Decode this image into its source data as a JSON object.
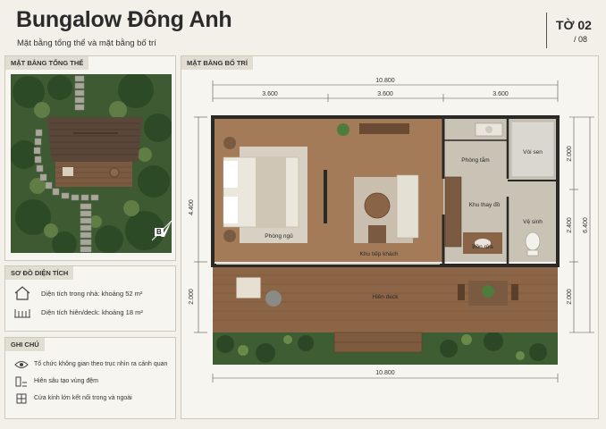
{
  "header": {
    "title": "Bungalow Đông Anh",
    "subtitle": "Mặt bằng tổng thể và mặt bằng bố trí",
    "sheet": "TỜ 02",
    "sheet_total": "/ 08"
  },
  "site_plan": {
    "label": "MẶT BẰNG TỔNG THỂ",
    "north_letter": "B"
  },
  "area_table": {
    "label": "SƠ ĐỒ DIỆN TÍCH",
    "rows": [
      {
        "icon": "house-icon",
        "text": "Diện tích trong nhà: khoảng 52 m²"
      },
      {
        "icon": "deck-icon",
        "text": "Diện tích hiên/deck: khoảng 18 m²"
      }
    ]
  },
  "notes": {
    "label": "GHI CHÚ",
    "rows": [
      {
        "icon": "eye-icon",
        "text": "Tổ chức không gian theo trục nhìn ra cảnh quan"
      },
      {
        "icon": "layers-icon",
        "text": "Hiên sâu tạo vùng đệm"
      },
      {
        "icon": "window-icon",
        "text": "Cửa kính lớn kết nối trong và ngoài"
      }
    ]
  },
  "floor_plan": {
    "label": "MẶT BẰNG BỐ TRÍ",
    "dim_total_top": "10.800",
    "dim_top": [
      "3.600",
      "3.600",
      "3.600"
    ],
    "dim_total_bottom": "10.800",
    "dim_left": [
      "4.400",
      "2.000"
    ],
    "dim_right": [
      "2.000",
      "2.400",
      "2.000"
    ],
    "dim_right_total": "6.400",
    "rooms": {
      "bedroom": "Phòng ngủ",
      "living": "Khu tiếp khách",
      "bath": "Phòng tắm",
      "shower": "Vòi sen",
      "changing": "Khu thay đồ",
      "wc": "Vệ sinh",
      "sink": "Bồn rửa",
      "deck": "Hiên deck"
    }
  }
}
